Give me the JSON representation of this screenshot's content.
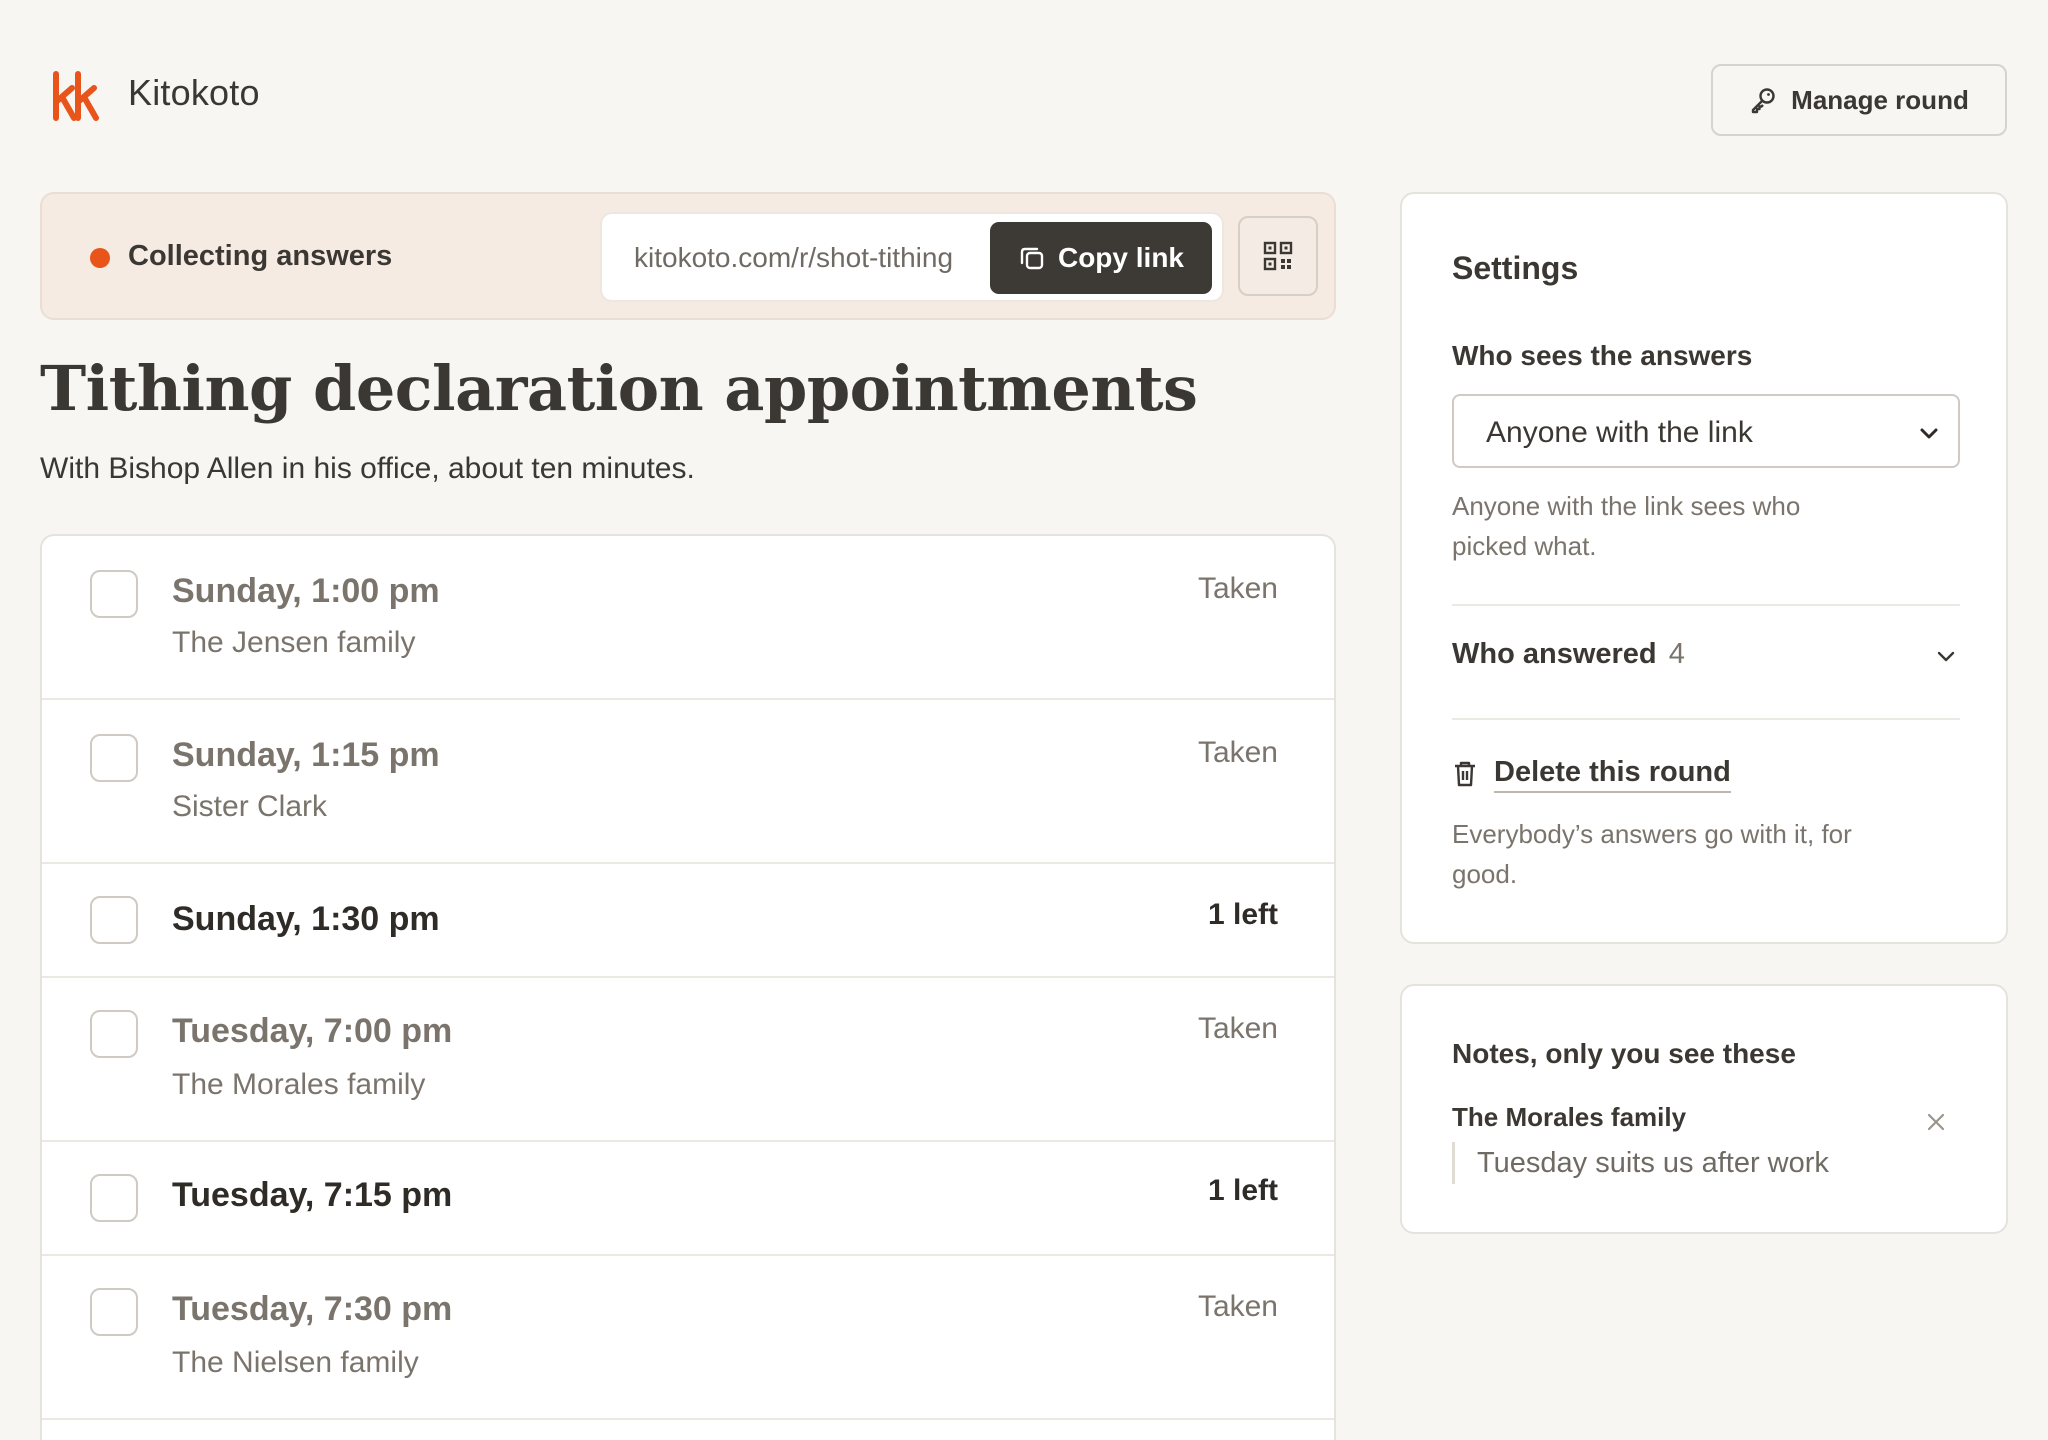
{
  "header": {
    "brand_name": "Kitokoto",
    "manage_label": "Manage round"
  },
  "status_bar": {
    "status": "Collecting answers",
    "link_url": "kitokoto.com/r/shot-tithing",
    "copy_label": "Copy link"
  },
  "page": {
    "title": "Tithing declaration appointments",
    "subtitle": "With Bishop Allen in his office, about ten minutes."
  },
  "slots": [
    {
      "time": "Sunday, 1:00 pm",
      "who": "The Jensen family",
      "status": "Taken"
    },
    {
      "time": "Sunday, 1:15 pm",
      "who": "Sister Clark",
      "status": "Taken"
    },
    {
      "time": "Sunday, 1:30 pm",
      "who": "",
      "status": "1 left"
    },
    {
      "time": "Tuesday, 7:00 pm",
      "who": "The Morales family",
      "status": "Taken"
    },
    {
      "time": "Tuesday, 7:15 pm",
      "who": "",
      "status": "1 left"
    },
    {
      "time": "Tuesday, 7:30 pm",
      "who": "The Nielsen family",
      "status": "Taken"
    }
  ],
  "settings": {
    "title": "Settings",
    "who_sees_label": "Who sees the answers",
    "visibility_value": "Anyone with the link",
    "visibility_help": "Anyone with the link sees who picked what.",
    "who_answered_label": "Who answered",
    "who_answered_count": "4",
    "delete_label": "Delete this round",
    "delete_help": "Everybody’s answers go with it, for good."
  },
  "notes": {
    "title": "Notes, only you see these",
    "items": [
      {
        "author": "The Morales family",
        "text": "Tuesday suits us after work"
      }
    ]
  },
  "colors": {
    "accent": "#e8541a",
    "dark_button": "#3d3934",
    "status_bar_bg": "#f5ebe3",
    "page_bg": "#f7f6f2"
  },
  "icons": {
    "logo": "kitokoto-logo",
    "manage": "key-icon",
    "copy": "copy-icon",
    "qr": "qr-code-icon",
    "select": "chevron-down-icon",
    "expand": "chevron-down-icon",
    "delete": "trash-icon",
    "close": "close-icon"
  }
}
